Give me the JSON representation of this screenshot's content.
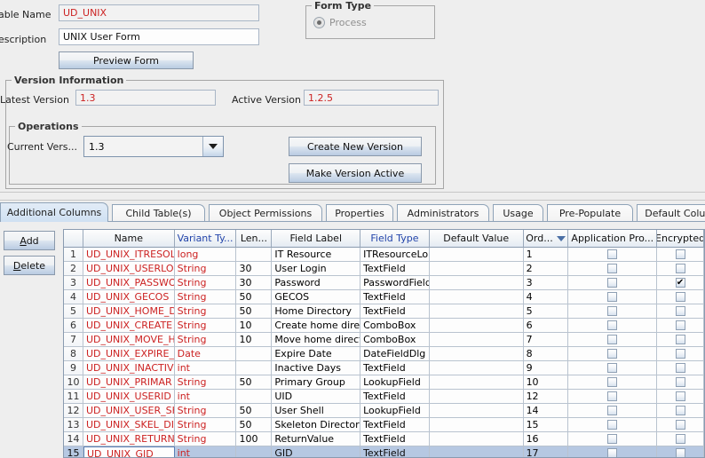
{
  "form": {
    "table_name_label": "able Name",
    "table_name_value": "UD_UNIX",
    "description_label": "escription",
    "description_value": "UNIX User Form",
    "preview_button": "Preview Form"
  },
  "form_type": {
    "title": "Form Type",
    "option_process": "Process"
  },
  "version_information": {
    "title": "Version Information",
    "latest_version_label": "Latest Version",
    "latest_version_value": "1.3",
    "active_version_label": "Active Version",
    "active_version_value": "1.2.5"
  },
  "operations": {
    "title": "Operations",
    "current_version_label": "Current Vers...",
    "current_version_value": "1.3",
    "create_new_version_button": "Create New Version",
    "make_version_active_button": "Make Version Active"
  },
  "tabs": [
    {
      "label": "Additional Columns",
      "selected": true
    },
    {
      "label": "Child Table(s)",
      "selected": false
    },
    {
      "label": "Object Permissions",
      "selected": false
    },
    {
      "label": "Properties",
      "selected": false
    },
    {
      "label": "Administrators",
      "selected": false
    },
    {
      "label": "Usage",
      "selected": false
    },
    {
      "label": "Pre-Populate",
      "selected": false
    },
    {
      "label": "Default Columns",
      "selected": false
    }
  ],
  "side_buttons": {
    "add": {
      "pre": "",
      "mnemonic": "A",
      "post": "dd"
    },
    "delete": {
      "pre": "",
      "mnemonic": "D",
      "post": "elete"
    }
  },
  "table": {
    "columns": [
      {
        "label": "",
        "key": "rownum",
        "blue": false,
        "sorted": false
      },
      {
        "label": "Name",
        "key": "name",
        "blue": false,
        "sorted": false
      },
      {
        "label": "Variant Ty...",
        "key": "variant",
        "blue": true,
        "sorted": false
      },
      {
        "label": "Len...",
        "key": "length",
        "blue": false,
        "sorted": false
      },
      {
        "label": "Field Label",
        "key": "field_label",
        "blue": false,
        "sorted": false
      },
      {
        "label": "Field Type",
        "key": "field_type",
        "blue": true,
        "sorted": false
      },
      {
        "label": "Default Value",
        "key": "default_value",
        "blue": false,
        "sorted": false
      },
      {
        "label": "Ord...",
        "key": "order",
        "blue": false,
        "sorted": true
      },
      {
        "label": "Application Pro...",
        "key": "app_profile",
        "blue": false,
        "sorted": false
      },
      {
        "label": "Encrypted",
        "key": "encrypted",
        "blue": false,
        "sorted": false
      }
    ],
    "rows": [
      {
        "rownum": "1",
        "name": "UD_UNIX_ITRESOL",
        "variant": "long",
        "length": "",
        "field_label": "IT Resource",
        "field_type": "ITResourceLo",
        "default_value": "",
        "order": "1",
        "app_profile": false,
        "encrypted": false,
        "selected": false,
        "editing": false
      },
      {
        "rownum": "2",
        "name": "UD_UNIX_USERLO",
        "variant": "String",
        "length": "30",
        "field_label": "User Login",
        "field_type": "TextField",
        "default_value": "",
        "order": "2",
        "app_profile": false,
        "encrypted": false,
        "selected": false,
        "editing": false
      },
      {
        "rownum": "3",
        "name": "UD_UNIX_PASSWO",
        "variant": "String",
        "length": "30",
        "field_label": "Password",
        "field_type": "PasswordField",
        "default_value": "",
        "order": "3",
        "app_profile": false,
        "encrypted": true,
        "selected": false,
        "editing": false
      },
      {
        "rownum": "4",
        "name": "UD_UNIX_GECOS",
        "variant": "String",
        "length": "50",
        "field_label": "GECOS",
        "field_type": "TextField",
        "default_value": "",
        "order": "4",
        "app_profile": false,
        "encrypted": false,
        "selected": false,
        "editing": false
      },
      {
        "rownum": "5",
        "name": "UD_UNIX_HOME_D",
        "variant": "String",
        "length": "50",
        "field_label": "Home Directory",
        "field_type": "TextField",
        "default_value": "",
        "order": "5",
        "app_profile": false,
        "encrypted": false,
        "selected": false,
        "editing": false
      },
      {
        "rownum": "6",
        "name": "UD_UNIX_CREATE",
        "variant": "String",
        "length": "10",
        "field_label": "Create home direc",
        "field_type": "ComboBox",
        "default_value": "",
        "order": "6",
        "app_profile": false,
        "encrypted": false,
        "selected": false,
        "editing": false
      },
      {
        "rownum": "7",
        "name": "UD_UNIX_MOVE_H",
        "variant": "String",
        "length": "10",
        "field_label": "Move home direct",
        "field_type": "ComboBox",
        "default_value": "",
        "order": "7",
        "app_profile": false,
        "encrypted": false,
        "selected": false,
        "editing": false
      },
      {
        "rownum": "8",
        "name": "UD_UNIX_EXPIRE_",
        "variant": "Date",
        "length": "",
        "field_label": "Expire Date",
        "field_type": "DateFieldDlg",
        "default_value": "",
        "order": "8",
        "app_profile": false,
        "encrypted": false,
        "selected": false,
        "editing": false
      },
      {
        "rownum": "9",
        "name": "UD_UNIX_INACTIV",
        "variant": "int",
        "length": "",
        "field_label": "Inactive Days",
        "field_type": "TextField",
        "default_value": "",
        "order": "9",
        "app_profile": false,
        "encrypted": false,
        "selected": false,
        "editing": false
      },
      {
        "rownum": "10",
        "name": "UD_UNIX_PRIMAR",
        "variant": "String",
        "length": "50",
        "field_label": "Primary Group",
        "field_type": "LookupField",
        "default_value": "",
        "order": "10",
        "app_profile": false,
        "encrypted": false,
        "selected": false,
        "editing": false
      },
      {
        "rownum": "11",
        "name": "UD_UNIX_USERID",
        "variant": "int",
        "length": "",
        "field_label": "UID",
        "field_type": "TextField",
        "default_value": "",
        "order": "12",
        "app_profile": false,
        "encrypted": false,
        "selected": false,
        "editing": false
      },
      {
        "rownum": "12",
        "name": "UD_UNIX_USER_SH",
        "variant": "String",
        "length": "50",
        "field_label": "User Shell",
        "field_type": "LookupField",
        "default_value": "",
        "order": "14",
        "app_profile": false,
        "encrypted": false,
        "selected": false,
        "editing": false
      },
      {
        "rownum": "13",
        "name": "UD_UNIX_SKEL_DI",
        "variant": "String",
        "length": "50",
        "field_label": "Skeleton Directory",
        "field_type": "TextField",
        "default_value": "",
        "order": "15",
        "app_profile": false,
        "encrypted": false,
        "selected": false,
        "editing": false
      },
      {
        "rownum": "14",
        "name": "UD_UNIX_RETURN",
        "variant": "String",
        "length": "100",
        "field_label": "ReturnValue",
        "field_type": "TextField",
        "default_value": "",
        "order": "16",
        "app_profile": false,
        "encrypted": false,
        "selected": false,
        "editing": false
      },
      {
        "rownum": "15",
        "name": "UD_UNIX_GID",
        "variant": "int",
        "length": "",
        "field_label": "GID",
        "field_type": "TextField",
        "default_value": "",
        "order": "17",
        "app_profile": false,
        "encrypted": false,
        "selected": true,
        "editing": true
      }
    ]
  },
  "colors": {
    "value_red": "#cc2222",
    "header_blue": "#2244aa",
    "selection": "#b6c8e2",
    "background": "#eeeeee"
  }
}
